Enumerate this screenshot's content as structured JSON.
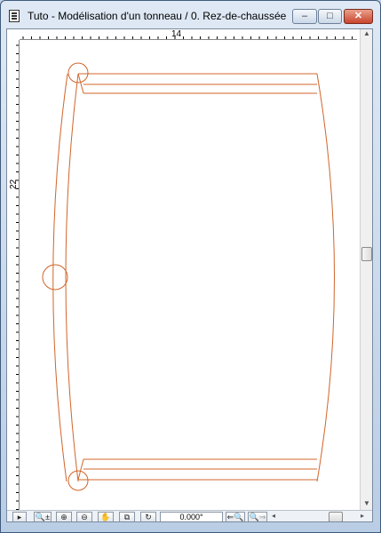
{
  "window": {
    "title": "Tuto - Modélisation d'un tonneau / 0. Rez-de-chaussée",
    "minimize_label": "‒",
    "maximize_label": "□",
    "close_label": "✕"
  },
  "rulers": {
    "top_label": "14",
    "left_label": "22"
  },
  "drawing": {
    "stroke_color": "#d0652a"
  },
  "statusbar": {
    "angle_value": "0.000°",
    "play_label": "▸",
    "zoom_pm_label": "🔍±",
    "zoom_in_label": "⊕",
    "zoom_out_label": "⊖",
    "pan_label": "✋",
    "fit_label": "⧉",
    "rotate_label": "↻",
    "zoom_prev_label": "⇐🔍",
    "zoom_next_label": "🔍⇒"
  },
  "icons": {
    "app": "document-icon",
    "scroll_up": "▲",
    "scroll_down": "▼",
    "scroll_left": "◂",
    "scroll_right": "▸"
  }
}
